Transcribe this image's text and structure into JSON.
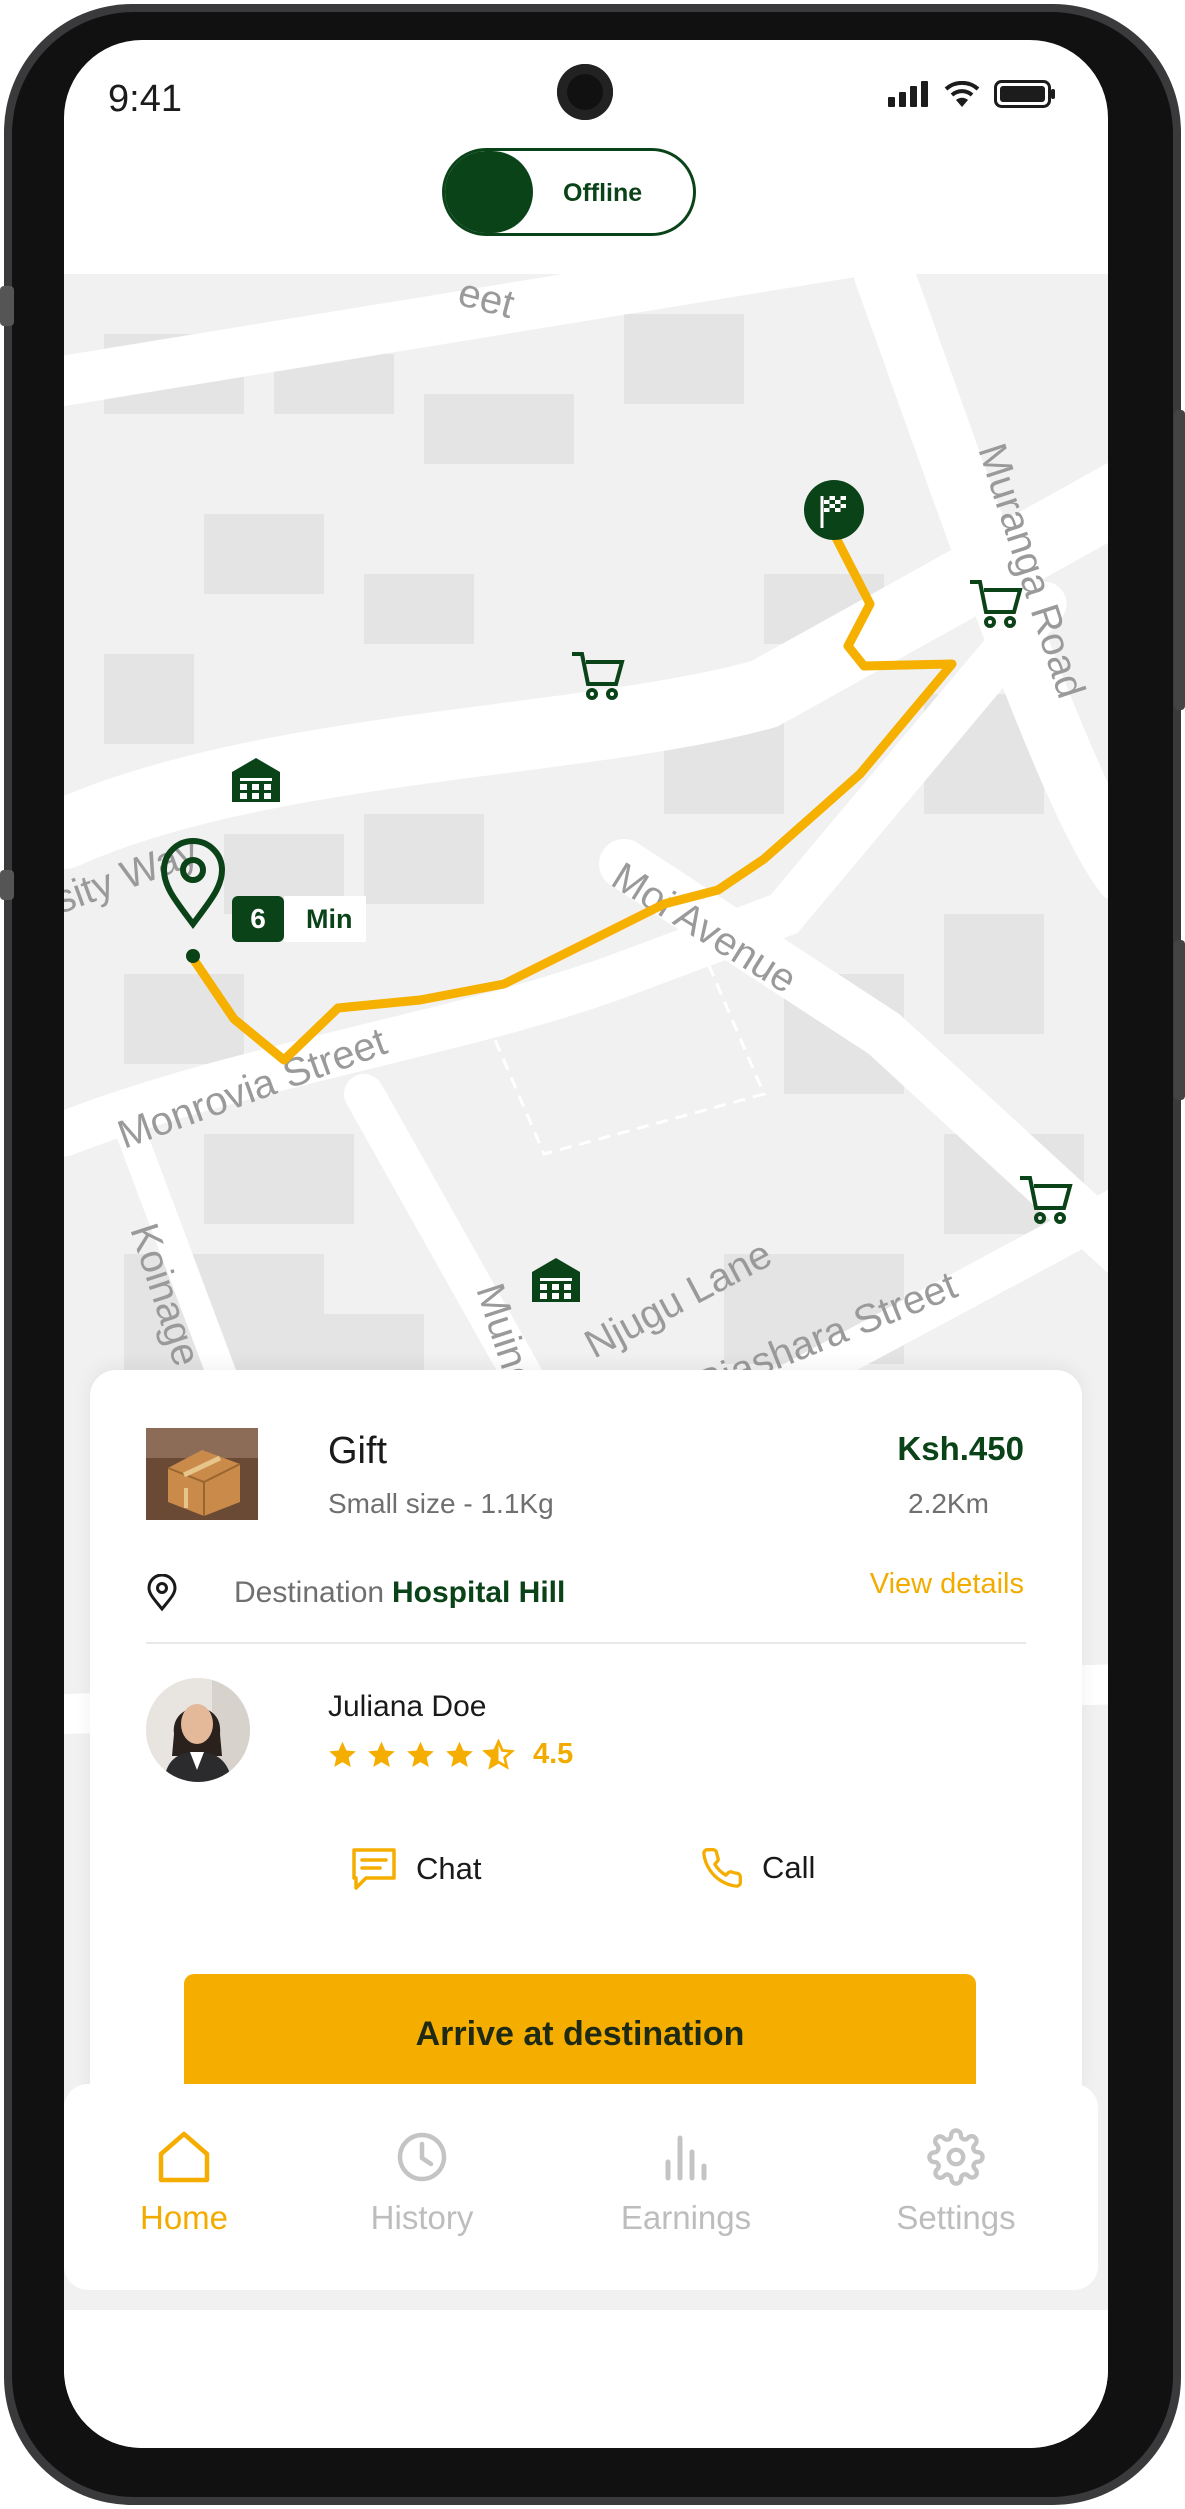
{
  "status_bar": {
    "time": "9:41"
  },
  "availability_toggle": {
    "label": "Offline"
  },
  "map": {
    "street_labels": [
      "Moi Avenue",
      "Monrovia Street",
      "Muranga Road",
      "Njugu Lane",
      "Biashara Street",
      "sity Way",
      "Koinage",
      "Muind",
      "eet"
    ],
    "eta": {
      "value": "6",
      "unit": "Min"
    }
  },
  "delivery": {
    "item_name": "Gift",
    "item_size": "Small size - 1.1Kg",
    "price": "Ksh.450",
    "distance": "2.2Km",
    "destination_label": "Destination",
    "destination_value": "Hospital Hill",
    "view_details": "View details"
  },
  "driver": {
    "name": "Juliana Doe",
    "rating": "4.5",
    "rating_value": 4.5
  },
  "actions": {
    "chat": "Chat",
    "call": "Call",
    "primary": "Arrive at destination"
  },
  "nav": [
    {
      "label": "Home",
      "icon": "home-icon",
      "active": true
    },
    {
      "label": "History",
      "icon": "clock-icon",
      "active": false
    },
    {
      "label": "Earnings",
      "icon": "bar-chart-icon",
      "active": false
    },
    {
      "label": "Settings",
      "icon": "gear-icon",
      "active": false
    }
  ],
  "colors": {
    "primary_green": "#0b4319",
    "accent_yellow": "#f5ad00",
    "route": "#f5b000",
    "map_bg": "#f0f1f0",
    "road": "#ffffff"
  }
}
